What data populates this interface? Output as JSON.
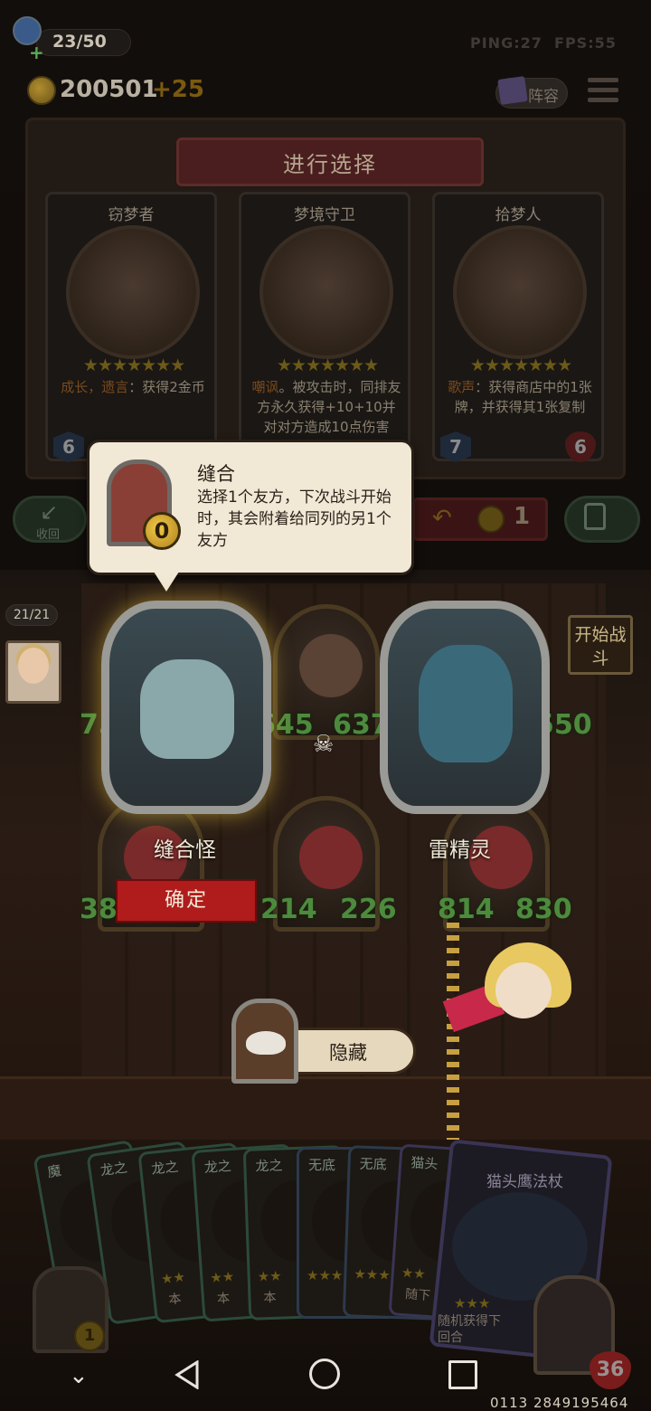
{
  "hud": {
    "health": "23/50",
    "ping": "PING:27",
    "fps": "FPS:55",
    "gold": "200501",
    "gold_delta": "+25",
    "lineup_label": "阵容"
  },
  "selection": {
    "title": "进行选择",
    "cards": [
      {
        "name": "窃梦者",
        "desc_hl": "成长，遗言",
        "desc_text": "：获得2金币",
        "attack": "6",
        "health": ""
      },
      {
        "name": "梦境守卫",
        "desc_hl": "嘲讽",
        "desc_text": "。被攻击时，同排友方永久获得+10+10并对对方造成10点伤害",
        "attack": "",
        "health": ""
      },
      {
        "name": "拾梦人",
        "desc_hl": "歌声",
        "desc_text": "：获得商店中的1张牌，并获得其1张复制",
        "attack": "7",
        "health": "6"
      }
    ],
    "back_label": "收回",
    "refresh_cost": "1"
  },
  "tooltip": {
    "title": "缝合",
    "body": "选择1个友方，下次战斗开始时，其会附着给同列的另1个友方",
    "cost": "0"
  },
  "board": {
    "player_health": "21/21",
    "start_battle": "开始战斗",
    "selected_left": {
      "name": "缝合怪"
    },
    "selected_right": {
      "name": "雷精灵"
    },
    "top_stats": [
      "75",
      "645",
      "637",
      "550"
    ],
    "bottom_stats": [
      "38",
      "214",
      "226",
      "814",
      "830"
    ],
    "confirm_label": "确定",
    "hide_label": "隐藏"
  },
  "hand": {
    "cards": [
      {
        "title": "魔",
        "text": ""
      },
      {
        "title": "龙之",
        "text": ""
      },
      {
        "title": "龙之",
        "text": "本"
      },
      {
        "title": "龙之",
        "text": "本"
      },
      {
        "title": "龙之",
        "text": "本"
      },
      {
        "title": "无底",
        "text": ""
      },
      {
        "title": "无底",
        "text": ""
      },
      {
        "title": "猫头",
        "text": "随下"
      }
    ],
    "featured": {
      "title": "猫头鹰法杖",
      "text": "随机获得下回合"
    },
    "shop_cost": "1",
    "hero_health": "36"
  },
  "system": {
    "version": "0113 2849195464"
  }
}
